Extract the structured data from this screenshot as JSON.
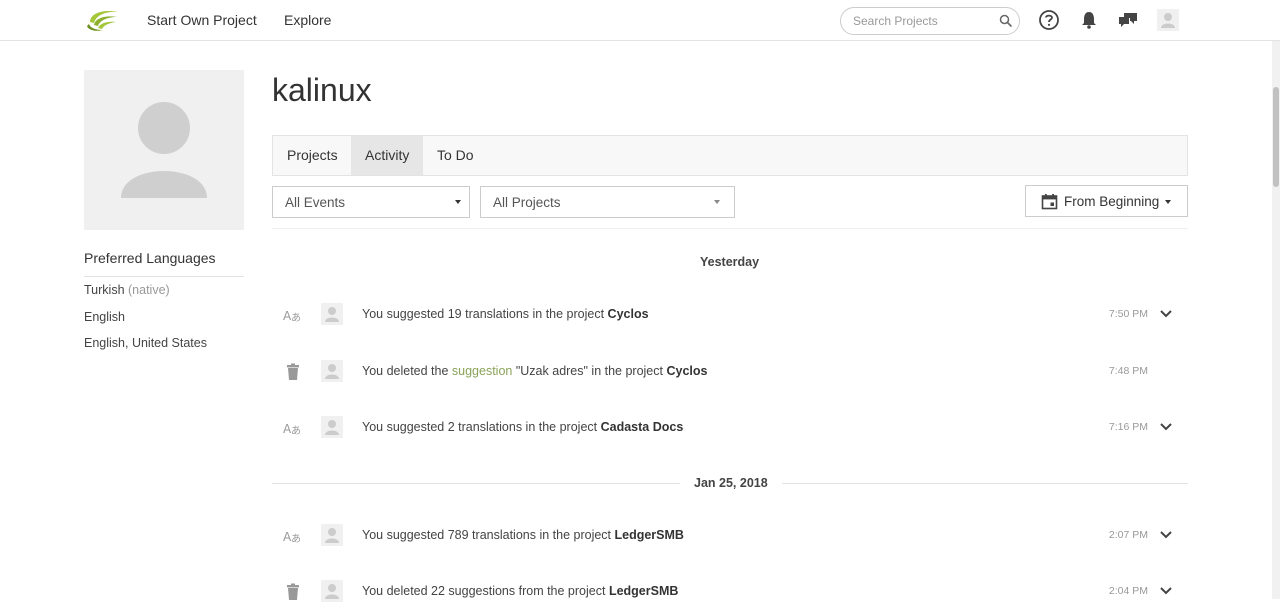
{
  "nav": {
    "start_own_project": "Start Own Project",
    "explore": "Explore",
    "search_placeholder": "Search Projects",
    "icons": [
      "help-icon",
      "bell-icon",
      "messages-icon",
      "user-avatar-icon"
    ]
  },
  "profile": {
    "username": "kalinux",
    "preferred_languages_title": "Preferred Languages",
    "languages": [
      {
        "name": "Turkish",
        "note": "(native)"
      },
      {
        "name": "English",
        "note": ""
      },
      {
        "name": "English, United States",
        "note": ""
      }
    ]
  },
  "tabs": [
    {
      "label": "Projects",
      "active": false
    },
    {
      "label": "Activity",
      "active": true
    },
    {
      "label": "To Do",
      "active": false
    }
  ],
  "filters": {
    "events": "All Events",
    "projects": "All Projects",
    "date_range": "From Beginning"
  },
  "colors": {
    "link": "#8aa45a",
    "logo_green": "#a4c639"
  },
  "days": [
    {
      "label": "Yesterday",
      "events": [
        {
          "icon": "translate-icon",
          "pre": "You suggested 19 translations in the project ",
          "link": "",
          "mid": "",
          "project": "Cyclos",
          "time": "7:50 PM",
          "expandable": true
        },
        {
          "icon": "trash-icon",
          "pre": "You deleted the ",
          "link": "suggestion",
          "mid": " \"Uzak adres\" in the project ",
          "project": "Cyclos",
          "time": "7:48 PM",
          "expandable": false
        },
        {
          "icon": "translate-icon",
          "pre": "You suggested 2 translations in the project ",
          "link": "",
          "mid": "",
          "project": "Cadasta Docs",
          "time": "7:16 PM",
          "expandable": true
        }
      ]
    },
    {
      "label": "Jan 25, 2018",
      "events": [
        {
          "icon": "translate-icon",
          "pre": "You suggested 789 translations in the project ",
          "link": "",
          "mid": "",
          "project": "LedgerSMB",
          "time": "2:07 PM",
          "expandable": true
        },
        {
          "icon": "trash-icon",
          "pre": "You deleted 22 suggestions from the project ",
          "link": "",
          "mid": "",
          "project": "LedgerSMB",
          "time": "2:04 PM",
          "expandable": true
        }
      ]
    }
  ]
}
